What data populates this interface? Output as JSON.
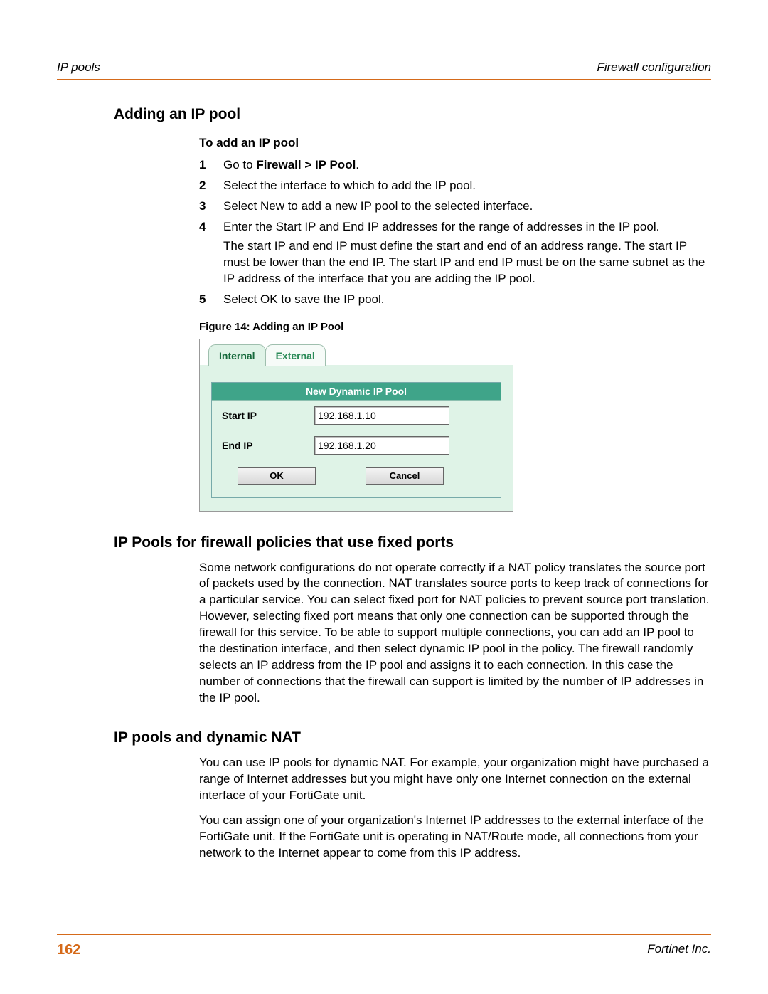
{
  "runningHead": {
    "left": "IP pools",
    "right": "Firewall configuration"
  },
  "heading1": "Adding an IP pool",
  "procedureTitle": "To add an IP pool",
  "steps": {
    "s1_prefix": "Go to ",
    "s1_path": "Firewall > IP Pool",
    "s1_suffix": ".",
    "s2": "Select the interface to which to add the IP pool.",
    "s3": "Select New to add a new IP pool to the selected interface.",
    "s4": "Enter the Start IP and End IP addresses for the range of addresses in the IP pool.",
    "s4_note": "The start IP and end IP must define the start and end of an address range. The start IP must be lower than the end IP. The start IP and end IP must be on the same subnet as the IP address of the interface that you are adding the IP pool.",
    "s5": "Select OK to save the IP pool."
  },
  "figureCaption": "Figure 14: Adding an IP Pool",
  "figure": {
    "tabs": {
      "internal": "Internal",
      "external": "External"
    },
    "panelTitle": "New Dynamic IP Pool",
    "labels": {
      "startIp": "Start IP",
      "endIp": "End IP"
    },
    "values": {
      "startIp": "192.168.1.10",
      "endIp": "192.168.1.20"
    },
    "buttons": {
      "ok": "OK",
      "cancel": "Cancel"
    }
  },
  "section2": {
    "title": "IP Pools for firewall policies that use fixed ports",
    "para": "Some network configurations do not operate correctly if a NAT policy translates the source port of packets used by the connection. NAT translates source ports to keep track of connections for a particular service. You can select fixed port for NAT policies to prevent source port translation. However, selecting fixed port means that only one connection can be supported through the firewall for this service. To be able to support multiple connections, you can add an IP pool to the destination interface, and then select dynamic IP pool in the policy. The firewall randomly selects an IP address from the IP pool and assigns it to each connection. In this case the number of connections that the firewall can support is limited by the number of IP addresses in the IP pool."
  },
  "section3": {
    "title": "IP pools and dynamic NAT",
    "para1": "You can use IP pools for dynamic NAT. For example, your organization might have purchased a range of Internet addresses but you might have only one Internet connection on the external interface of your FortiGate unit.",
    "para2": "You can assign one of your organization's Internet IP addresses to the external interface of the FortiGate unit. If the FortiGate unit is operating in NAT/Route mode, all connections from your network to the Internet appear to come from this IP address."
  },
  "footer": {
    "pageNumber": "162",
    "company": "Fortinet Inc."
  }
}
